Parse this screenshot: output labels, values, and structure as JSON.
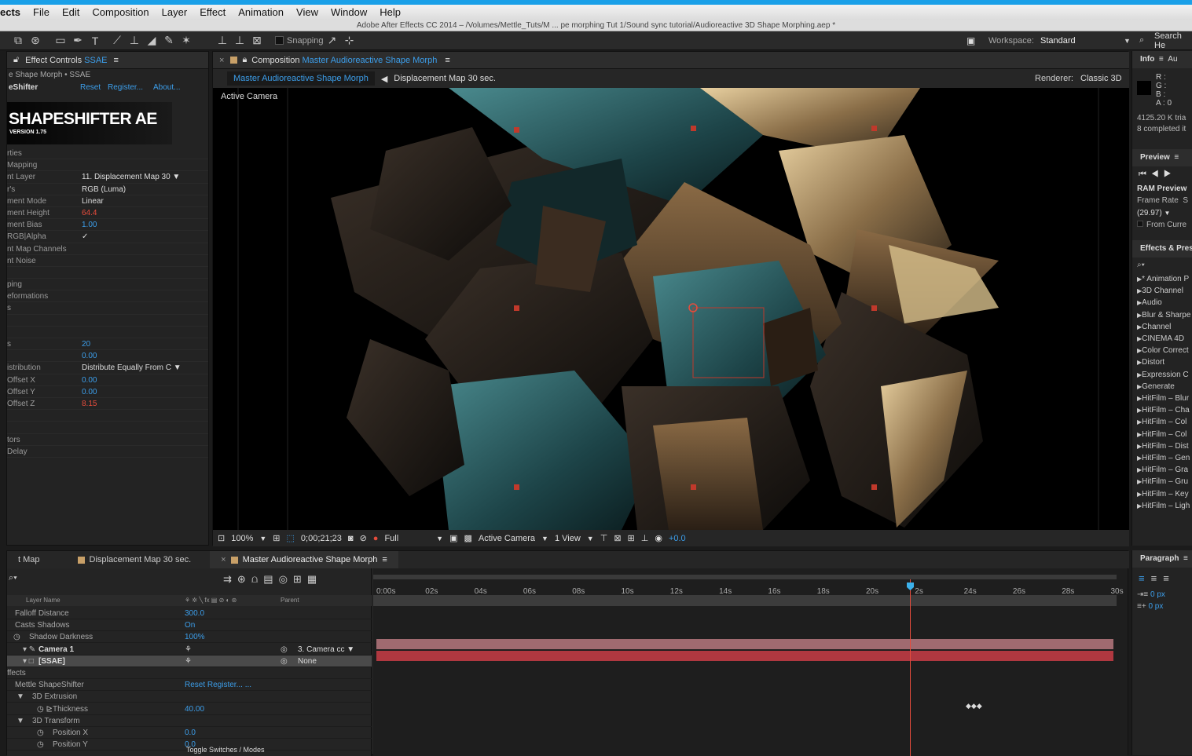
{
  "menu": {
    "app_label": "ects",
    "items": [
      "File",
      "Edit",
      "Composition",
      "Layer",
      "Effect",
      "Animation",
      "View",
      "Window",
      "Help"
    ]
  },
  "window_title": "Adobe After Effects CC 2014 – /Volumes/Mettle_Tuts/M ... pe morphing Tut 1/Sound sync tutorial/Audioreactive 3D Shape Morphing.aep *",
  "toolbar": {
    "snapping_label": "Snapping",
    "workspace_label": "Workspace:",
    "workspace_value": "Standard",
    "search_label": "Search He"
  },
  "effect_controls": {
    "tab_label": "Effect Controls",
    "tab_layer": "SSAE",
    "breadcrumb": "e Shape Morph • SSAE",
    "effect_name": "eShifter",
    "reset": "Reset",
    "register": "Register...",
    "about": "About...",
    "logo_title": "SHAPESHIFTER AE",
    "logo_version": "VERSION 1.75",
    "props": [
      {
        "label": "rties",
        "value": "",
        "color": ""
      },
      {
        "label": "Mapping",
        "value": "",
        "color": ""
      },
      {
        "label": "nt Layer",
        "value": "11. Displacement Map 30 ▼",
        "color": "#ddd"
      },
      {
        "label": "r's",
        "value": "RGB (Luma)",
        "color": "#ddd"
      },
      {
        "label": "ment Mode",
        "value": "Linear",
        "color": "#ddd"
      },
      {
        "label": "ment Height",
        "value": "64.4",
        "color": "#e74c3c"
      },
      {
        "label": "ment Bias",
        "value": "1.00",
        "color": "#3c9eea"
      },
      {
        "label": "RGB|Alpha",
        "value": "✓",
        "color": "#ddd"
      },
      {
        "label": "nt Map Channels",
        "value": "",
        "color": ""
      },
      {
        "label": "nt Noise",
        "value": "",
        "color": ""
      },
      {
        "label": "",
        "value": "",
        "color": ""
      },
      {
        "label": "ping",
        "value": "",
        "color": ""
      },
      {
        "label": "eformations",
        "value": "",
        "color": ""
      },
      {
        "label": "s",
        "value": "",
        "color": ""
      },
      {
        "label": "",
        "value": "",
        "color": ""
      },
      {
        "label": "",
        "value": "",
        "color": ""
      },
      {
        "label": "s",
        "value": "20",
        "color": "#3c9eea"
      },
      {
        "label": "",
        "value": "0.00",
        "color": "#3c9eea"
      },
      {
        "label": "istribution",
        "value": "Distribute Equally From C ▼",
        "color": "#ddd"
      },
      {
        "label": " Offset X",
        "value": "0.00",
        "color": "#3c9eea"
      },
      {
        "label": " Offset Y",
        "value": "0.00",
        "color": "#3c9eea"
      },
      {
        "label": " Offset Z",
        "value": "8.15",
        "color": "#e74c3c"
      },
      {
        "label": "",
        "value": "",
        "color": ""
      },
      {
        "label": "",
        "value": "",
        "color": ""
      },
      {
        "label": "tors",
        "value": "",
        "color": ""
      },
      {
        "label": "Delay",
        "value": "",
        "color": ""
      }
    ]
  },
  "viewer": {
    "tab_label": "Composition",
    "tab_comp": "Master Audioreactive Shape Morph",
    "crumb_active": "Master Audioreactive Shape Morph",
    "crumb_next": "Displacement Map 30 sec.",
    "renderer_label": "Renderer:",
    "renderer_value": "Classic 3D",
    "camera_label": "Active Camera",
    "footer": {
      "zoom": "100%",
      "timecode": "0;00;21;23",
      "resolution": "Full",
      "view": "Active Camera",
      "views": "1 View",
      "exposure": "+0.0"
    }
  },
  "info": {
    "title": "Info",
    "tab2": "Au",
    "r": "R :",
    "g": "G :",
    "b": "B :",
    "a": "A : 0",
    "line1": "4125.20 K tria",
    "line2": "8 completed it"
  },
  "preview": {
    "title": "Preview",
    "ram": "RAM Preview",
    "frame_rate_label": "Frame Rate",
    "frame_rate_col2": "S",
    "fps": "(29.97)",
    "from_current": "From Curre"
  },
  "effects_presets": {
    "title": "Effects & Prese",
    "items": [
      "* Animation P",
      "3D Channel",
      "Audio",
      "Blur & Sharpe",
      "Channel",
      "CINEMA 4D",
      "Color Correct",
      "Distort",
      "Expression C",
      "Generate",
      "HitFilm – Blur",
      "HitFilm – Cha",
      "HitFilm – Col",
      "HitFilm – Col",
      "HitFilm – Dist",
      "HitFilm – Gen",
      "HitFilm – Gra",
      "HitFilm – Gru",
      "HitFilm – Key",
      "HitFilm – Ligh"
    ]
  },
  "paragraph": {
    "title": "Paragraph",
    "indent1": "0 px",
    "indent2": "0 px"
  },
  "timeline": {
    "tabs": [
      "t Map",
      "Displacement Map 30 sec.",
      "Master Audioreactive Shape Morph"
    ],
    "col_layer": "Layer Name",
    "col_parent": "Parent",
    "rows": [
      {
        "label": "Falloff Distance",
        "value": "300.0"
      },
      {
        "label": "Casts Shadows",
        "value": "On"
      },
      {
        "label": "Shadow Darkness",
        "value": "100%"
      },
      {
        "label": "Camera 1",
        "value": "",
        "parent": "3. Camera cc ▼"
      },
      {
        "label": "[SSAE]",
        "value": "",
        "parent": "None"
      },
      {
        "label": "ffects",
        "value": ""
      },
      {
        "label": "Mettle ShapeShifter",
        "value": "Reset  Register...   ..."
      },
      {
        "label": "3D Extrusion",
        "value": ""
      },
      {
        "label": "Thickness",
        "value": "40.00"
      },
      {
        "label": "3D Transform",
        "value": ""
      },
      {
        "label": "Position X",
        "value": "0.0"
      },
      {
        "label": "Position Y",
        "value": "0.0"
      }
    ],
    "ruler": [
      "0:00s",
      "02s",
      "04s",
      "06s",
      "08s",
      "10s",
      "12s",
      "14s",
      "16s",
      "18s",
      "20s",
      "2s",
      "24s",
      "26s",
      "28s",
      "30s"
    ],
    "toggle_label": "Toggle Switches / Modes"
  }
}
